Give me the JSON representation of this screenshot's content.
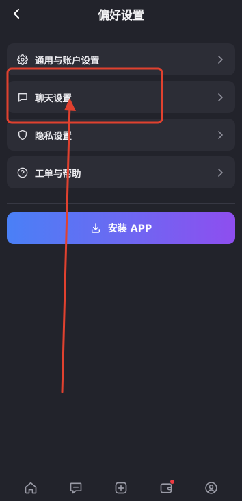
{
  "header": {
    "title": "偏好设置",
    "back_icon": "chevron-left-icon"
  },
  "menu": {
    "items": [
      {
        "label": "通用与账户设置",
        "icon": "gear-icon"
      },
      {
        "label": "聊天设置",
        "icon": "chat-bubble-icon"
      },
      {
        "label": "隐私设置",
        "icon": "shield-icon"
      },
      {
        "label": "工单与帮助",
        "icon": "help-circle-icon"
      }
    ],
    "chevron_icon": "chevron-right-icon"
  },
  "install": {
    "label": "安装 APP",
    "icon": "download-icon",
    "gradient": [
      "#4a80f6",
      "#8e4eef"
    ]
  },
  "tabbar": {
    "items": [
      {
        "icon": "home-icon"
      },
      {
        "icon": "message-icon"
      },
      {
        "icon": "plus-square-icon"
      },
      {
        "icon": "wallet-icon",
        "has_badge": true
      },
      {
        "icon": "profile-icon"
      }
    ],
    "badge_color": "#ef3b42"
  },
  "colors": {
    "background": "#22232b",
    "card": "#2c2d36",
    "annotation": "#e0412f"
  }
}
